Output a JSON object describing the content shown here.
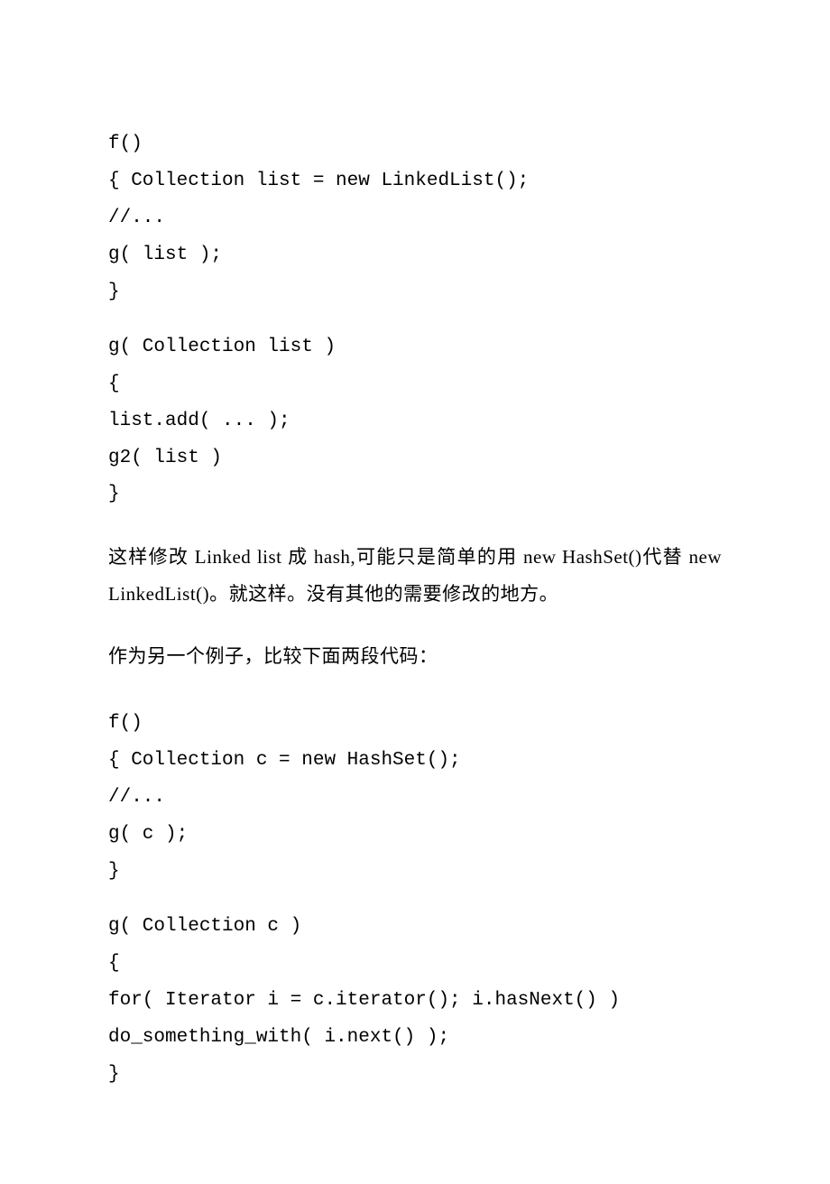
{
  "code": {
    "block1": "f()\n{ Collection list = new LinkedList();\n//...\ng( list );\n}",
    "block2": "g( Collection list )\n{\nlist.add( ... );\ng2( list )\n}",
    "block3": "f()\n{ Collection c = new HashSet();\n//...\ng( c );\n}",
    "block4": "g( Collection c )\n{\nfor( Iterator i = c.iterator(); i.hasNext() )\ndo_something_with( i.next() );\n}"
  },
  "prose": {
    "p1": "这样修改 Linked list 成 hash,可能只是简单的用 new HashSet()代替 new LinkedList()。就这样。没有其他的需要修改的地方。",
    "p2": "作为另一个例子，比较下面两段代码："
  }
}
